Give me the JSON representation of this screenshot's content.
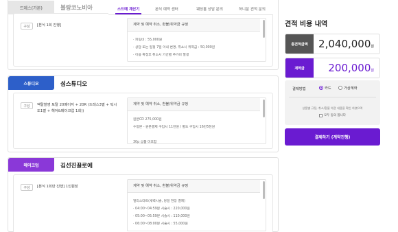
{
  "nav": {
    "tabs": [
      "스드메 계산기",
      "본식 예약 센터",
      "웨딩홀 상담 문의",
      "허니문 견적 문의"
    ],
    "active_index": 0
  },
  "vendors": [
    {
      "badge": "드레스(가본)",
      "name": "블랑코노비아",
      "badge_color": "#e6e6e6",
      "chip": "구성",
      "package": "[본식 1회 진행]",
      "policy_title": "계약 및 예약 취소, 환불/위약금 규정",
      "policy_lines": [
        "· 피팅비 : 55,000원",
        "· 상담 또는 일정 7일 이내 변경, 취소시 위약금 : 50,000원",
        "· 이용 확정후 취소시 기간별 추가비 발생"
      ]
    },
    {
      "badge": "스튜디오",
      "name": "섬스튜디오",
      "badge_color": "#2d5fc9",
      "chip": "구성",
      "package": "액탈촬영 토탈 20페이지 + 20R (드레스3벌 + 턱시도1벌 + 헤어&메이크업 1회))",
      "policy_title": "계약 및 예약 취소, 환불/위약금 규정",
      "policy_lines": [
        "원본CD 275,000원",
        "수정본 - 원본결제 구입시 11만원 / 별도 구입시 16만5천원",
        "",
        "30p 상품 미포함"
      ]
    },
    {
      "badge": "메이크업",
      "name": "김선진끌로에",
      "badge_color": "#8a38d8",
      "chip": "구성",
      "package": "[본식 1회만 진행] 1인원장",
      "policy_title": "계약 및 예약 취소, 환불/위약금 규정",
      "policy_lines": [
        "얼리스타트(새벽시술, 당일 현장 결제)",
        "· 04:00~04:59분 시술시 : 220,000원",
        "· 05:00~05:59분 시술시 : 110,000원",
        "· 06:00~08:00분 시술시 : 55,000원"
      ]
    }
  ],
  "summary": {
    "title": "견적 비용 내역",
    "total_label": "총견적금액",
    "total_value": "2,040,000",
    "deposit_label": "계약금",
    "deposit_value": "200,000",
    "unit": "원",
    "pay_method_label": "결제방법",
    "pay_options": [
      "카드",
      "가상계좌"
    ],
    "pay_selected": 0,
    "agree_text": "상품별 규정, 취소/환불 약관 내용을 확인 하였으며",
    "agree_check_label": "모두 동의 합니다",
    "pay_button": "결제하기 (계약진행)"
  },
  "colors": {
    "accent": "#6a1bd1",
    "studio": "#2d5fc9",
    "makeup": "#8a38d8",
    "dark_label": "#555555"
  }
}
